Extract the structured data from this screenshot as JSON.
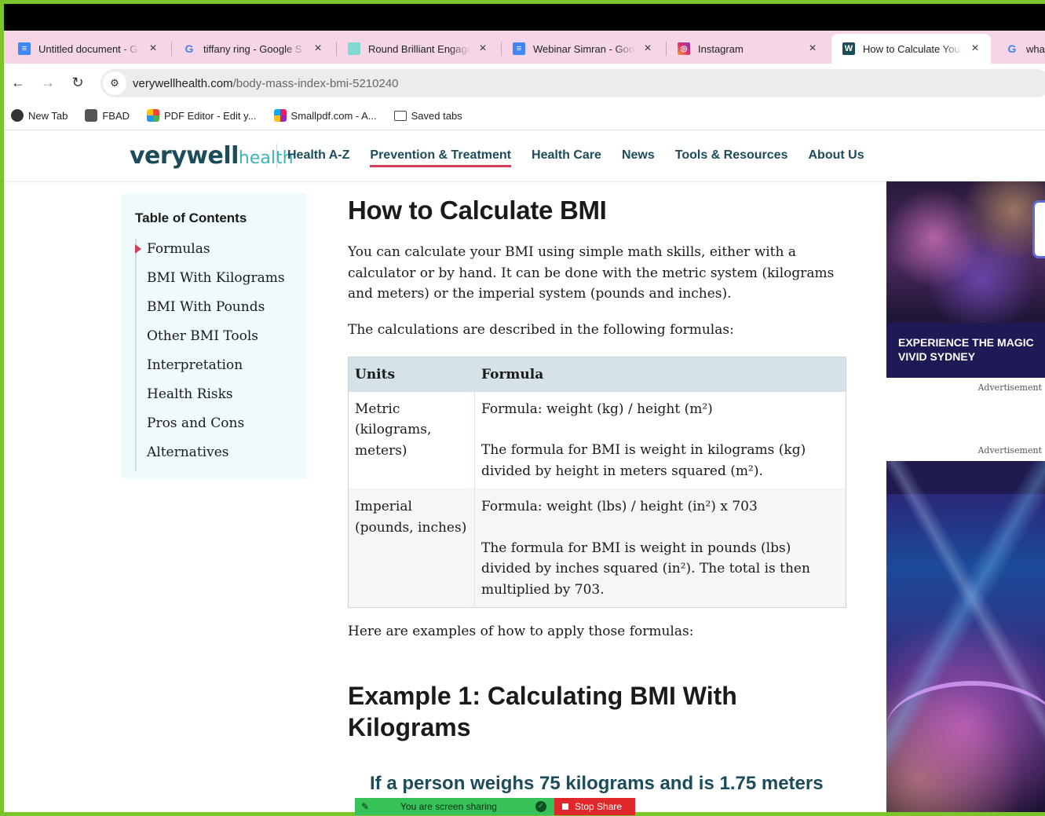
{
  "browser": {
    "tabs": [
      {
        "title": "Untitled document - G",
        "icon": "google-docs-icon",
        "color": "#4285f4"
      },
      {
        "title": "tiffany ring - Google S",
        "icon": "google-icon",
        "color": "#ffffff"
      },
      {
        "title": "Round Brilliant Engage",
        "icon": "tiffany-icon",
        "color": "#81d8d0"
      },
      {
        "title": "Webinar Simran - Goo",
        "icon": "google-docs-icon",
        "color": "#4285f4"
      },
      {
        "title": "Instagram",
        "icon": "instagram-icon",
        "color": "#e1306c"
      },
      {
        "title": "How to Calculate Your",
        "icon": "verywell-icon",
        "color": "#1c4b5a",
        "active": true
      },
      {
        "title": "what",
        "icon": "google-icon",
        "color": "#ffffff"
      }
    ],
    "url_domain": "verywellhealth.com",
    "url_path": "/body-mass-index-bmi-5210240",
    "bookmarks": [
      {
        "label": "New Tab",
        "icon": "globe-icon"
      },
      {
        "label": "FBAD",
        "icon": "save-icon"
      },
      {
        "label": "PDF Editor - Edit y...",
        "icon": "pdf-editor-icon"
      },
      {
        "label": "Smallpdf.com - A...",
        "icon": "smallpdf-icon"
      },
      {
        "label": "Saved tabs",
        "icon": "folder-icon"
      }
    ]
  },
  "site": {
    "logo_main": "verywell",
    "logo_sub": "health",
    "nav": [
      "Health A-Z",
      "Prevention & Treatment",
      "Health Care",
      "News",
      "Tools & Resources",
      "About Us"
    ],
    "active_nav": "Prevention & Treatment",
    "brand_color": "#1c4b5a",
    "accent_color": "#d23f5b"
  },
  "toc": {
    "title": "Table of Contents",
    "items": [
      "Formulas",
      "BMI With Kilograms",
      "BMI With Pounds",
      "Other BMI Tools",
      "Interpretation",
      "Health Risks",
      "Pros and Cons",
      "Alternatives"
    ],
    "active": "Formulas"
  },
  "article": {
    "title": "How to Calculate BMI",
    "intro": "You can calculate your BMI using simple math skills, either with a calculator or by hand. It can be done with the metric system (kilograms and meters) or the imperial system (pounds and inches).",
    "lead_in": "The calculations are described in the following formulas:",
    "table": {
      "headers": [
        "Units",
        "Formula"
      ],
      "rows": [
        {
          "units": "Metric (kilograms, meters)",
          "formula": "Formula: weight (kg) / height (m²)",
          "description": "The formula for BMI is weight in kilograms (kg) divided by height in meters squared (m²)."
        },
        {
          "units": "Imperial (pounds, inches)",
          "formula": "Formula: weight (lbs) / height (in²) x 703",
          "description": "The formula for BMI is weight in pounds (lbs) divided by inches squared (in²). The total is then multiplied by 703."
        }
      ]
    },
    "examples_intro": "Here are examples of how to apply those formulas:",
    "example1_title": "Example 1: Calculating BMI With Kilograms",
    "example1_image_text": "If a person weighs 75 kilograms and is 1.75 meters"
  },
  "ads": {
    "label": "Advertisement",
    "ad1_text": "EXPERIENCE THE MAGIC\nVIVID SYDNEY"
  },
  "screen_share": {
    "message": "You are screen sharing",
    "stop_label": "Stop Share"
  }
}
